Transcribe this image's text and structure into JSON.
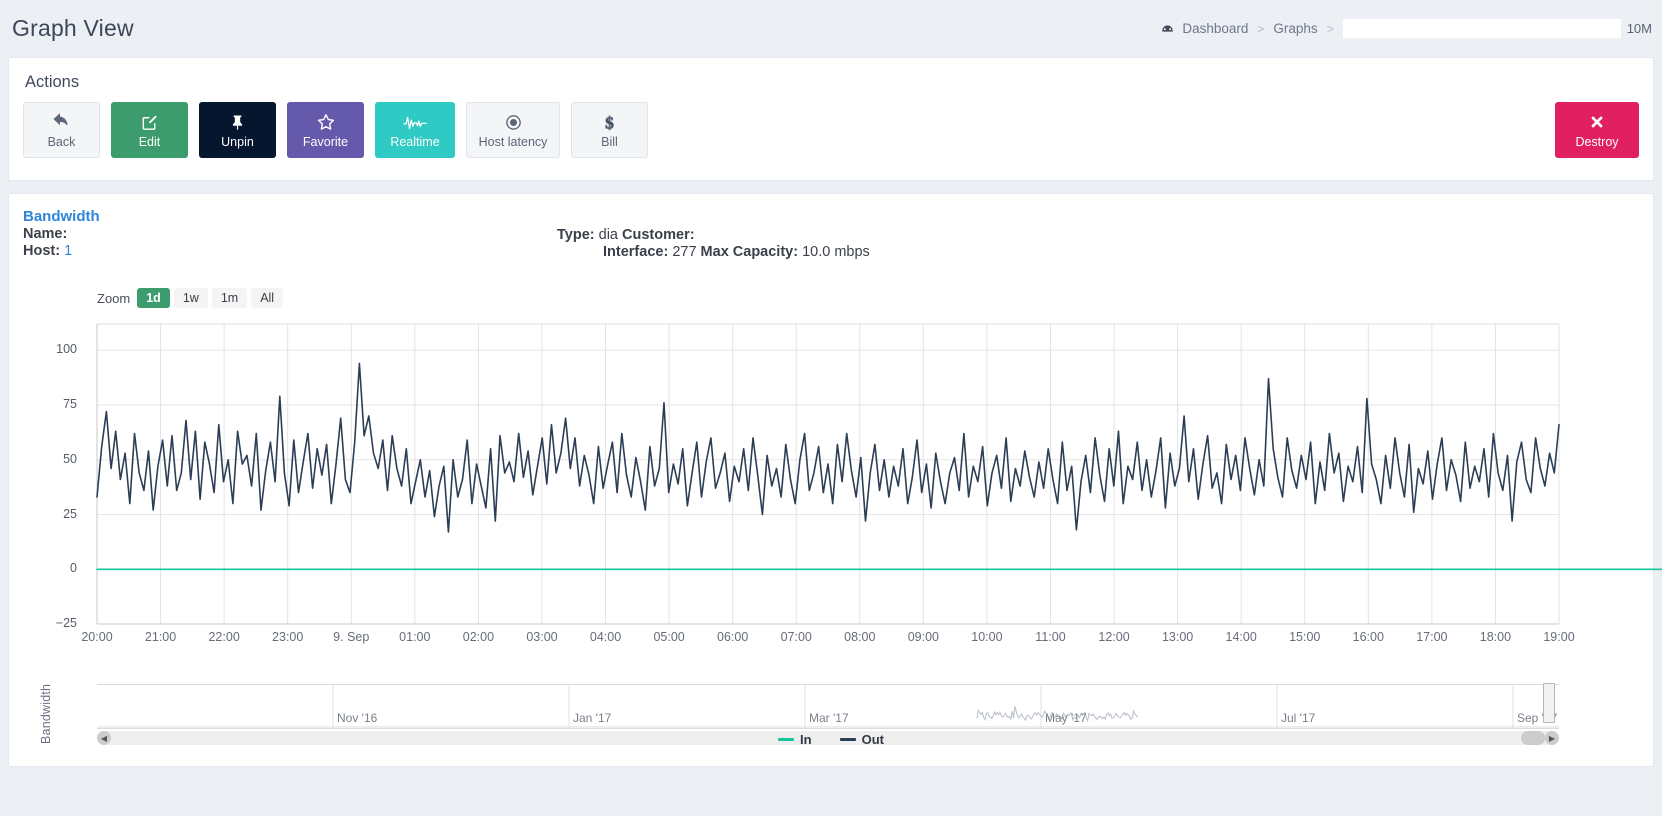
{
  "header": {
    "title": "Graph View",
    "breadcrumb": {
      "dashboard_icon": "dashboard-icon",
      "dashboard": "Dashboard",
      "sep1": ">",
      "graphs": "Graphs",
      "sep2": ">",
      "search_value": "",
      "search_placeholder": "",
      "size_label": "10M"
    }
  },
  "actions": {
    "title": "Actions",
    "buttons": [
      {
        "label": "Back",
        "icon": "undo-arrow-icon",
        "style": "plain"
      },
      {
        "label": "Edit",
        "icon": "pencil-square-icon",
        "style": "green"
      },
      {
        "label": "Unpin",
        "icon": "pushpin-icon",
        "style": "dark"
      },
      {
        "label": "Favorite",
        "icon": "star-icon",
        "style": "purple"
      },
      {
        "label": "Realtime",
        "icon": "pulse-icon",
        "style": "teal"
      },
      {
        "label": "Host latency",
        "icon": "target-dot-icon",
        "style": "plain"
      },
      {
        "label": "Bill",
        "icon": "dollar-icon",
        "style": "plain"
      }
    ],
    "destroy": {
      "label": "Destroy",
      "icon": "x-cross-icon",
      "color": "#e02060"
    }
  },
  "graph_info": {
    "title": "Bandwidth",
    "name_label": "Name:",
    "name_value": "",
    "host_label": "Host:",
    "host_value": "1",
    "type_label": "Type:",
    "type_value": "dia",
    "customer_label": "Customer:",
    "customer_value": "",
    "interface_label": "Interface:",
    "interface_value": "277",
    "capacity_label": "Max Capacity:",
    "capacity_value": "10.0 mbps"
  },
  "zoom": {
    "label": "Zoom",
    "options": [
      "1d",
      "1w",
      "1m",
      "All"
    ],
    "active": "1d"
  },
  "chart_data": {
    "type": "line",
    "title": "Bandwidth",
    "xlabel": "",
    "ylabel": "Bandwidth",
    "ylim": [
      -25,
      112
    ],
    "yticks": [
      100,
      75,
      50,
      25,
      0,
      -25
    ],
    "grid": true,
    "legend_position": "bottom",
    "xticks": [
      "20:00",
      "21:00",
      "22:00",
      "23:00",
      "9. Sep",
      "01:00",
      "02:00",
      "03:00",
      "04:00",
      "05:00",
      "06:00",
      "07:00",
      "08:00",
      "09:00",
      "10:00",
      "11:00",
      "12:00",
      "13:00",
      "14:00",
      "15:00",
      "16:00",
      "17:00",
      "18:00",
      "19:00"
    ],
    "series": [
      {
        "name": "In",
        "color": "#16c79a",
        "values": [
          0,
          0,
          0,
          0,
          0,
          0,
          0,
          0,
          0,
          0,
          0,
          0,
          0,
          0,
          0,
          0,
          0,
          0,
          0,
          0,
          0,
          0,
          0,
          0,
          0,
          0,
          0,
          0,
          0,
          0,
          0,
          0,
          0,
          0,
          0,
          0,
          0,
          0,
          0,
          0,
          0,
          0,
          0,
          0,
          0,
          0,
          0,
          0,
          0,
          0,
          0,
          0,
          0,
          0,
          0,
          0,
          0,
          0,
          0,
          0,
          0,
          0,
          0,
          0,
          0,
          0,
          0,
          0,
          0,
          0,
          0,
          0,
          0,
          0,
          0,
          0,
          0,
          0,
          0,
          0,
          0,
          0,
          0,
          0,
          0,
          0,
          0,
          0,
          0,
          0,
          0,
          0,
          0,
          0,
          0,
          0,
          0,
          0,
          0,
          0,
          0,
          0,
          0,
          0,
          0,
          0,
          0,
          0,
          0,
          0,
          0,
          0,
          0,
          0,
          0,
          0,
          0,
          0,
          0,
          0,
          0,
          0,
          0,
          0,
          0,
          0,
          0,
          0,
          0,
          0,
          0,
          0,
          0,
          0,
          0,
          0,
          0,
          0,
          0,
          0,
          0,
          0,
          0,
          0,
          0,
          0,
          0,
          0,
          0,
          0,
          0,
          0,
          0,
          0,
          0,
          0,
          0,
          0,
          0,
          0,
          0,
          0,
          0,
          0,
          0,
          0,
          0,
          0,
          0,
          0,
          0,
          0,
          0,
          0,
          0,
          0,
          0,
          0,
          0,
          0,
          0,
          0,
          0,
          0,
          0,
          0,
          0,
          0,
          0,
          0,
          0,
          0,
          0,
          0,
          0,
          0,
          0,
          0,
          0,
          0,
          0,
          0,
          0,
          0,
          0,
          0,
          0,
          0,
          0,
          0,
          0,
          0,
          0,
          0,
          0,
          0,
          0,
          0,
          0,
          0,
          0,
          0,
          0,
          0,
          0,
          0,
          0,
          0,
          0,
          0,
          0,
          0,
          0,
          0,
          0,
          0,
          0,
          0,
          0,
          0,
          0,
          0,
          0,
          0,
          0,
          0,
          0,
          0,
          0,
          0,
          0,
          0,
          0,
          0,
          0,
          0,
          0,
          0,
          0,
          0,
          0,
          0,
          0,
          0,
          0,
          0,
          0,
          0,
          0,
          0,
          0,
          0,
          0,
          0,
          0,
          0,
          0,
          0,
          0,
          0,
          0,
          0,
          0,
          0,
          0,
          0,
          0,
          0,
          0,
          0,
          0,
          0,
          0,
          0,
          0,
          0,
          0,
          0,
          0,
          0,
          0,
          0,
          0,
          0,
          0,
          0,
          0,
          0,
          0,
          0,
          0,
          0,
          0,
          0,
          0,
          0,
          0,
          0,
          0,
          0,
          0,
          0,
          0,
          0,
          0,
          0,
          0,
          0,
          0,
          0,
          0,
          0,
          0,
          0,
          0
        ]
      },
      {
        "name": "Out",
        "color": "#2c3e55",
        "values": [
          33,
          56,
          72,
          46,
          63,
          41,
          53,
          30,
          62,
          44,
          36,
          54,
          27,
          47,
          59,
          38,
          61,
          36,
          44,
          68,
          41,
          63,
          32,
          58,
          48,
          35,
          66,
          40,
          50,
          30,
          63,
          48,
          52,
          38,
          62,
          27,
          45,
          58,
          40,
          79,
          44,
          29,
          59,
          35,
          49,
          62,
          37,
          55,
          43,
          57,
          30,
          48,
          69,
          41,
          35,
          58,
          94,
          61,
          70,
          53,
          46,
          59,
          36,
          61,
          46,
          38,
          55,
          30,
          40,
          50,
          33,
          45,
          24,
          38,
          47,
          17,
          50,
          33,
          41,
          59,
          30,
          48,
          38,
          28,
          55,
          22,
          61,
          44,
          49,
          40,
          62,
          42,
          54,
          34,
          47,
          60,
          39,
          66,
          44,
          53,
          69,
          46,
          60,
          38,
          52,
          43,
          30,
          56,
          37,
          48,
          58,
          35,
          62,
          43,
          33,
          51,
          40,
          27,
          56,
          38,
          46,
          76,
          35,
          48,
          39,
          55,
          29,
          44,
          58,
          33,
          49,
          60,
          37,
          44,
          53,
          31,
          47,
          40,
          55,
          36,
          60,
          43,
          25,
          52,
          38,
          46,
          33,
          57,
          41,
          30,
          50,
          62,
          36,
          44,
          56,
          35,
          48,
          30,
          57,
          40,
          62,
          45,
          33,
          51,
          22,
          44,
          57,
          36,
          50,
          33,
          47,
          38,
          55,
          30,
          42,
          59,
          35,
          48,
          28,
          53,
          40,
          30,
          44,
          51,
          36,
          62,
          33,
          47,
          40,
          56,
          29,
          44,
          52,
          37,
          60,
          31,
          46,
          38,
          54,
          42,
          33,
          49,
          37,
          55,
          41,
          30,
          58,
          36,
          47,
          18,
          40,
          52,
          35,
          60,
          43,
          31,
          55,
          38,
          63,
          30,
          47,
          41,
          58,
          36,
          50,
          33,
          45,
          60,
          28,
          53,
          38,
          46,
          70,
          40,
          55,
          32,
          48,
          61,
          37,
          44,
          30,
          57,
          41,
          52,
          36,
          60,
          46,
          34,
          50,
          38,
          87,
          55,
          42,
          33,
          60,
          45,
          37,
          52,
          41,
          58,
          30,
          49,
          36,
          62,
          44,
          53,
          31,
          47,
          40,
          56,
          35,
          78,
          48,
          41,
          30,
          52,
          37,
          60,
          44,
          33,
          57,
          26,
          46,
          39,
          54,
          32,
          48,
          60,
          36,
          50,
          43,
          31,
          58,
          37,
          47,
          40,
          55,
          33,
          62,
          44,
          36,
          52,
          22,
          49,
          58,
          41,
          35,
          60,
          46,
          38,
          53,
          44,
          66
        ]
      }
    ],
    "navigator": {
      "ticks": [
        "Nov '16",
        "Jan '17",
        "Mar '17",
        "May '17",
        "Jul '17",
        "Sep '17"
      ]
    }
  },
  "legend": [
    {
      "label": "In",
      "color": "#16c79a"
    },
    {
      "label": "Out",
      "color": "#2c3e55"
    }
  ]
}
